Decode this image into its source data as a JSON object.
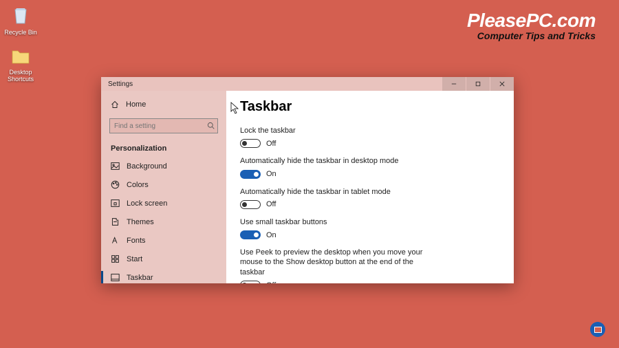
{
  "desktop": {
    "icons": [
      {
        "label": "Recycle Bin"
      },
      {
        "label": "Desktop Shortcuts"
      }
    ]
  },
  "watermark": {
    "title": "PleasePC.com",
    "subtitle": "Computer Tips and Tricks"
  },
  "window": {
    "title": "Settings",
    "home": "Home",
    "search_placeholder": "Find a setting",
    "category": "Personalization",
    "nav": [
      {
        "label": "Background"
      },
      {
        "label": "Colors"
      },
      {
        "label": "Lock screen"
      },
      {
        "label": "Themes"
      },
      {
        "label": "Fonts"
      },
      {
        "label": "Start"
      },
      {
        "label": "Taskbar"
      }
    ],
    "page_title": "Taskbar",
    "settings": [
      {
        "label": "Lock the taskbar",
        "state": "Off",
        "on": false
      },
      {
        "label": "Automatically hide the taskbar in desktop mode",
        "state": "On",
        "on": true
      },
      {
        "label": "Automatically hide the taskbar in tablet mode",
        "state": "Off",
        "on": false
      },
      {
        "label": "Use small taskbar buttons",
        "state": "On",
        "on": true
      },
      {
        "label": "Use Peek to preview the desktop when you move your mouse to the Show desktop button at the end of the taskbar",
        "state": "Off",
        "on": false
      }
    ]
  }
}
